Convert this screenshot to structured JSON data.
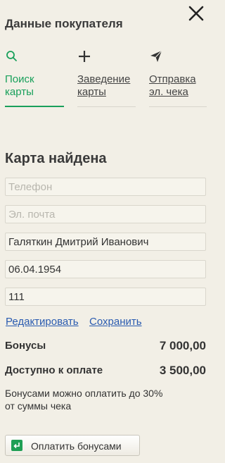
{
  "header": {
    "title": "Данные покупателя"
  },
  "tabs": [
    {
      "label": "Поиск карты",
      "icon": "search-icon",
      "active": true
    },
    {
      "label": "Заведение карты",
      "icon": "plus-icon",
      "active": false
    },
    {
      "label": "Отправка эл. чека",
      "icon": "send-icon",
      "active": false
    }
  ],
  "card": {
    "status_title": "Карта найдена",
    "phone": {
      "placeholder": "Телефон",
      "value": ""
    },
    "email": {
      "placeholder": "Эл. почта",
      "value": ""
    },
    "name": {
      "value": "Галяткин Дмитрий Иванович"
    },
    "birthdate": {
      "value": "06.04.1954"
    },
    "code": {
      "value": "111"
    },
    "edit_link": "Редактировать",
    "save_link": "Сохранить"
  },
  "bonus": {
    "bonuses_label": "Бонусы",
    "bonuses_value": "7 000,00",
    "available_label": "Доступно к оплате",
    "available_value": "3 500,00",
    "note": "Бонусами можно оплатить до 30% от суммы чека"
  },
  "actions": {
    "pay_label": "Оплатить бонусами"
  },
  "colors": {
    "accent": "#19a05b",
    "link": "#2a5bb0",
    "background": "#f2efe6"
  }
}
